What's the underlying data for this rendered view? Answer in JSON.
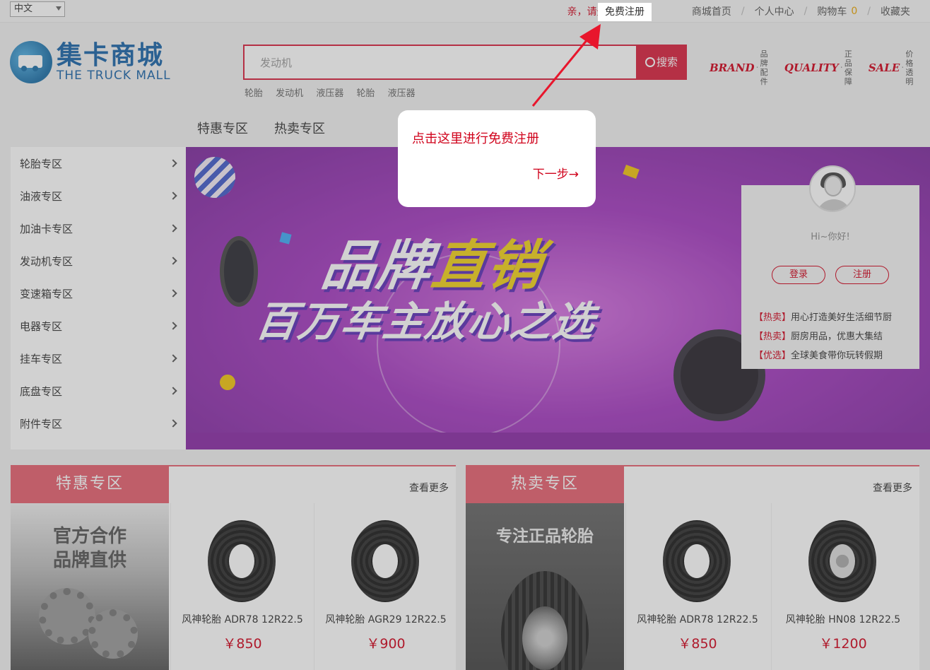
{
  "topbar": {
    "language": "中文",
    "greeting": "亲，请登录",
    "register": "免费注册",
    "links": [
      "商城首页",
      "个人中心",
      "购物车",
      "收藏夹"
    ],
    "cart_count": "0"
  },
  "logo": {
    "name_cn": "集卡商城",
    "name_en": "THE TRUCK MALL"
  },
  "search": {
    "value": "发动机",
    "button": "搜索",
    "hotwords": [
      "轮胎",
      "发动机",
      "液压器",
      "轮胎",
      "液压器"
    ]
  },
  "badges": [
    {
      "big": "BRAND",
      "small1": "品牌",
      "small2": "配件"
    },
    {
      "big": "QUALITY",
      "small1": "正品",
      "small2": "保障"
    },
    {
      "big": "SALE",
      "small1": "价格",
      "small2": "透明"
    }
  ],
  "nav": [
    "特惠专区",
    "热卖专区"
  ],
  "categories": [
    "轮胎专区",
    "油液专区",
    "加油卡专区",
    "发动机专区",
    "变速箱专区",
    "电器专区",
    "挂车专区",
    "底盘专区",
    "附件专区"
  ],
  "banner": {
    "line1a": "品牌",
    "line1b": "直销",
    "line2": "百万车主放心之选"
  },
  "user_card": {
    "hello": "Hi~你好!",
    "login": "登录",
    "register": "注册",
    "news": [
      {
        "tag": "【热卖】",
        "text": "用心打造美好生活细节厨"
      },
      {
        "tag": "【热卖】",
        "text": "厨房用品，优惠大集结"
      },
      {
        "tag": "【优选】",
        "text": "全球美食带你玩转假期"
      }
    ]
  },
  "tooltip": {
    "text": "点击这里进行免费注册",
    "next": "下一步→"
  },
  "sections": [
    {
      "title": "特惠专区",
      "more": "查看更多",
      "promo": [
        "官方合作",
        "品牌直供"
      ],
      "products": [
        {
          "name": "风神轮胎 ADR78 12R22.5",
          "price": "￥850"
        },
        {
          "name": "风神轮胎 AGR29 12R22.5",
          "price": "￥900"
        }
      ]
    },
    {
      "title": "热卖专区",
      "more": "查看更多",
      "promo": [
        "专注正品轮胎"
      ],
      "products": [
        {
          "name": "风神轮胎 ADR78 12R22.5",
          "price": "￥850"
        },
        {
          "name": "风神轮胎 HN08 12R22.5",
          "price": "￥1200"
        }
      ]
    }
  ],
  "colors": {
    "accent": "#d9213e",
    "brand_blue": "#1a64a8",
    "section_head": "#e6606f",
    "banner": "#a43ac0"
  }
}
